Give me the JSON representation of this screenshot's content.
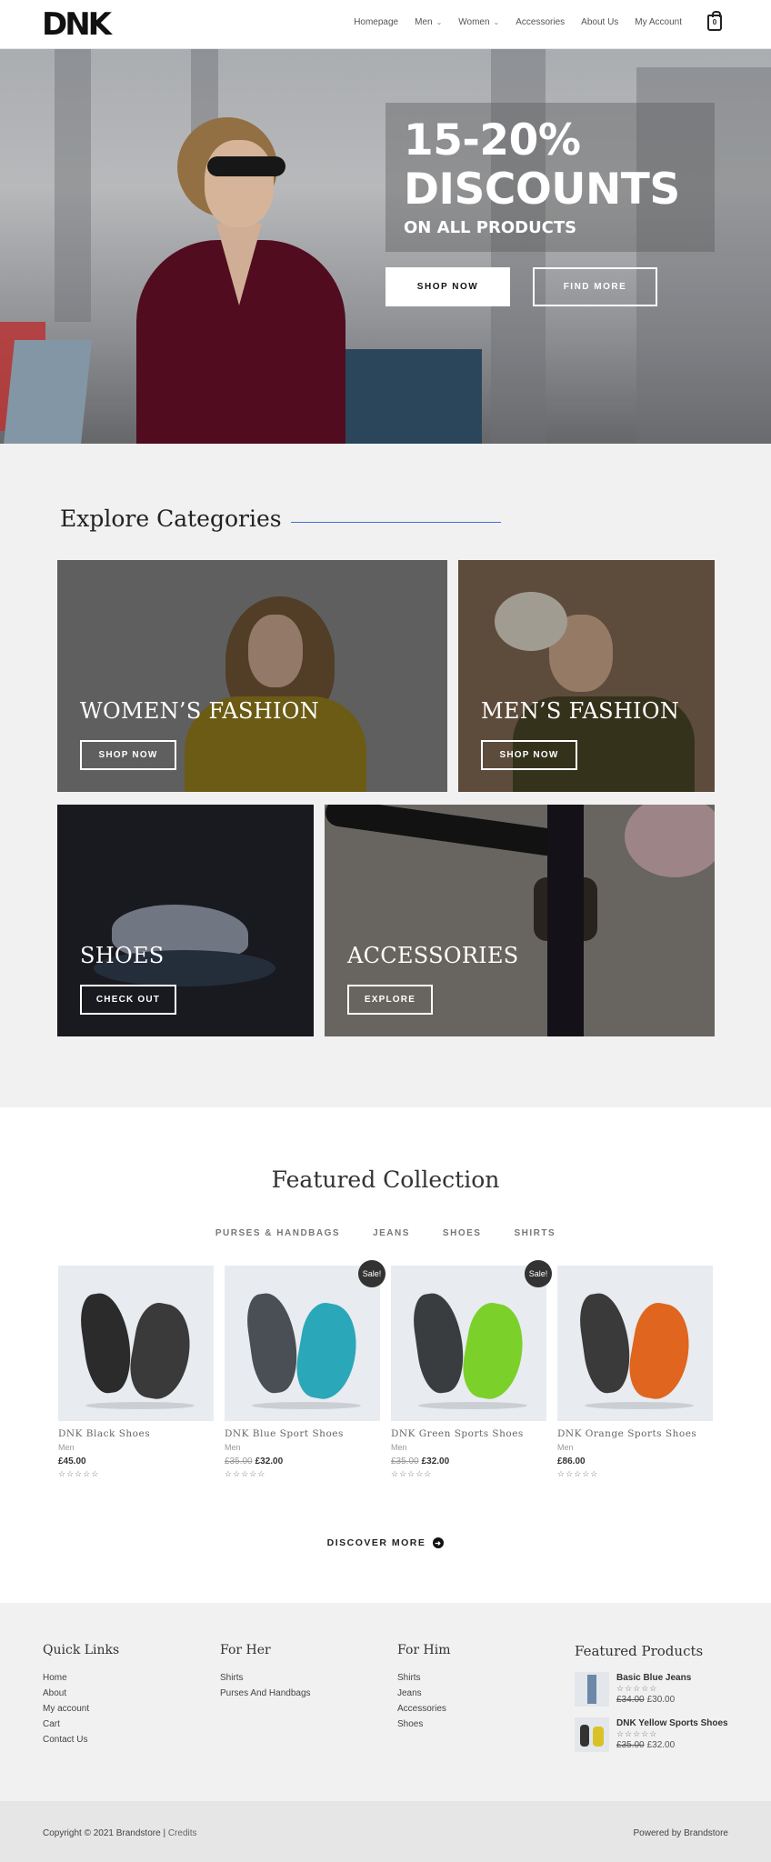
{
  "header": {
    "logo": "DNK",
    "nav": [
      {
        "label": "Homepage",
        "has_dropdown": false
      },
      {
        "label": "Men",
        "has_dropdown": true
      },
      {
        "label": "Women",
        "has_dropdown": true
      },
      {
        "label": "Accessories",
        "has_dropdown": false
      },
      {
        "label": "About Us",
        "has_dropdown": false
      },
      {
        "label": "My Account",
        "has_dropdown": false
      }
    ],
    "cart_count": "0"
  },
  "hero": {
    "headline_line1": "15-20%",
    "headline_line2": "DISCOUNTS",
    "subheadline": "ON ALL PRODUCTS",
    "primary_button": "SHOP NOW",
    "secondary_button": "FIND MORE"
  },
  "categories": {
    "title": "Explore Categories",
    "accent_color": "#4a6cd4",
    "cards": [
      {
        "title": "WOMEN’S FASHION",
        "button": "SHOP NOW"
      },
      {
        "title": "MEN’S FASHION",
        "button": "SHOP NOW"
      },
      {
        "title": "SHOES",
        "button": "CHECK OUT"
      },
      {
        "title": "ACCESSORIES",
        "button": "EXPLORE"
      }
    ]
  },
  "featured": {
    "title": "Featured Collection",
    "tabs": [
      "PURSES & HANDBAGS",
      "JEANS",
      "SHOES",
      "SHIRTS"
    ],
    "sale_badge": "Sale!",
    "products": [
      {
        "name": "DNK Black Shoes",
        "category": "Men",
        "old_price": "",
        "price": "£45.00",
        "on_sale": false,
        "accent": "#2b2b2b"
      },
      {
        "name": "DNK Blue Sport Shoes",
        "category": "Men",
        "old_price": "£35.00",
        "price": "£32.00",
        "on_sale": true,
        "accent": "#2aa7b8"
      },
      {
        "name": "DNK Green Sports Shoes",
        "category": "Men",
        "old_price": "£35.00",
        "price": "£32.00",
        "on_sale": true,
        "accent": "#7bd12a"
      },
      {
        "name": "DNK Orange Sports Shoes",
        "category": "Men",
        "old_price": "",
        "price": "£86.00",
        "on_sale": false,
        "accent": "#e0661f"
      }
    ],
    "discover_label": "DISCOVER MORE"
  },
  "footer": {
    "quick_links": {
      "title": "Quick Links",
      "items": [
        "Home",
        "About",
        "My account",
        "Cart",
        "Contact Us"
      ]
    },
    "for_her": {
      "title": "For Her",
      "items": [
        "Shirts",
        "Purses And Handbags"
      ]
    },
    "for_him": {
      "title": "For Him",
      "items": [
        "Shirts",
        "Jeans",
        "Accessories",
        "Shoes"
      ]
    },
    "featured_products": {
      "title": "Featured Products",
      "items": [
        {
          "name": "Basic Blue Jeans",
          "old_price": "£34.00",
          "price": "£30.00"
        },
        {
          "name": "DNK Yellow Sports Shoes",
          "old_price": "£35.00",
          "price": "£32.00"
        }
      ]
    },
    "copyright": "Copyright © 2021 Brandstore | ",
    "credits": "Credits",
    "powered_by": "Powered by Brandstore"
  },
  "rating_stars": "☆☆☆☆☆"
}
